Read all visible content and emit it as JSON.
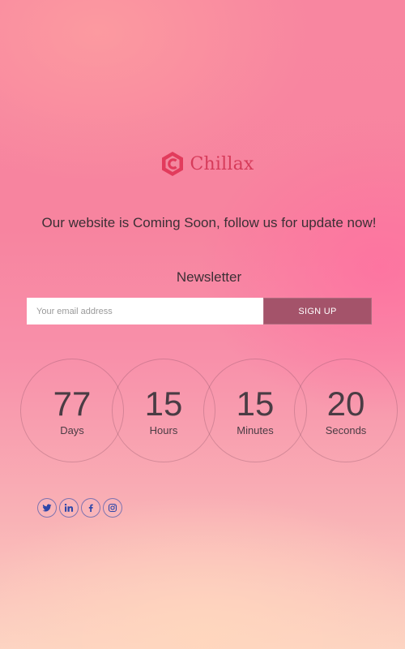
{
  "brand": {
    "name": "Chillax",
    "logo_icon": "hexagon-c-logo-icon",
    "color": "#d63b5a"
  },
  "tagline": "Our website is Coming Soon, follow us for update now!",
  "newsletter": {
    "title": "Newsletter",
    "email_placeholder": "Your email address",
    "email_value": "",
    "signup_label": "SIGN UP",
    "button_color": "#a4536a"
  },
  "countdown": [
    {
      "value": "77",
      "label": "Days"
    },
    {
      "value": "15",
      "label": "Hours"
    },
    {
      "value": "15",
      "label": "Minutes"
    },
    {
      "value": "20",
      "label": "Seconds"
    }
  ],
  "social": [
    {
      "icon": "twitter-icon"
    },
    {
      "icon": "linkedin-icon"
    },
    {
      "icon": "facebook-icon"
    },
    {
      "icon": "instagram-icon"
    }
  ],
  "colors": {
    "text": "#3c2f35",
    "social_icon": "#2f46a8"
  }
}
